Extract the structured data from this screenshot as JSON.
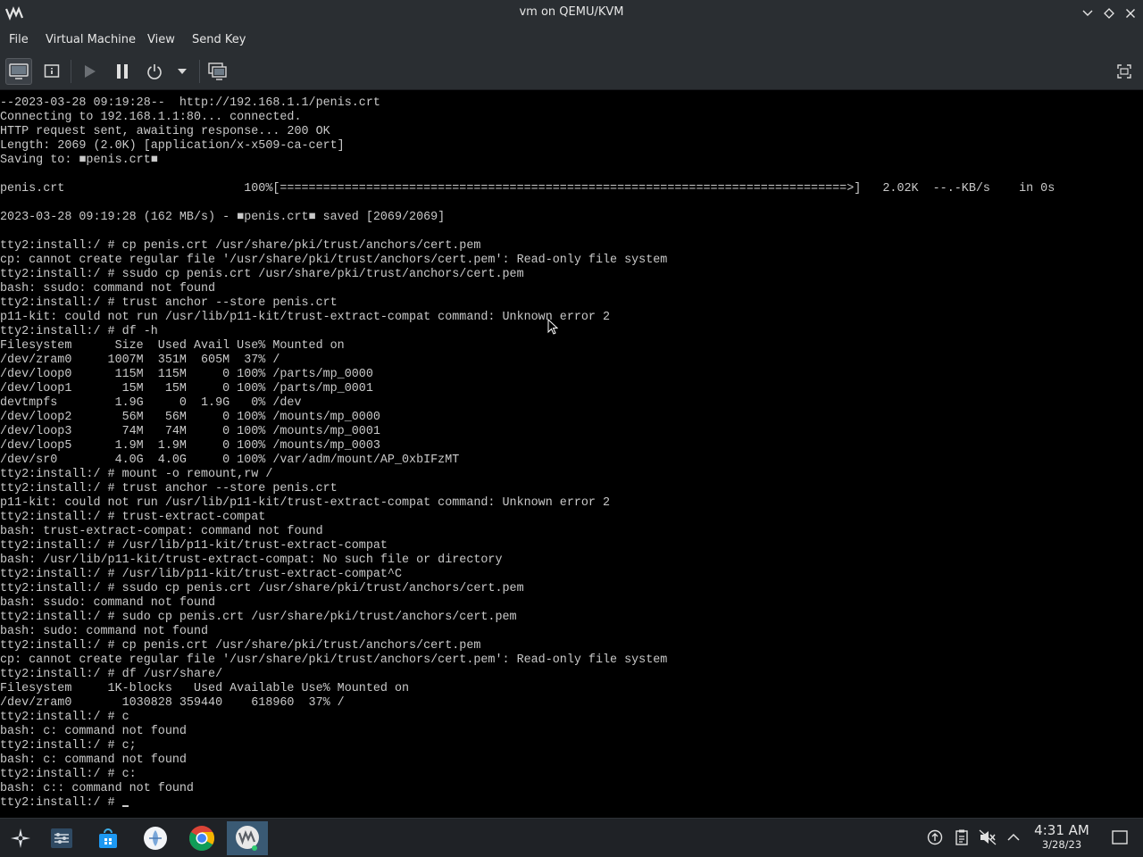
{
  "window": {
    "title": "vm on QEMU/KVM",
    "buttons": [
      "minimize",
      "maximize",
      "close"
    ]
  },
  "menu": {
    "file": "File",
    "virtual_machine": "Virtual Machine",
    "view": "View",
    "send_key": "Send Key"
  },
  "toolbar": {
    "icons": [
      "console-icon",
      "details-icon",
      "play-icon",
      "pause-icon",
      "power-icon",
      "dropdown-arrow-icon",
      "snapshots-icon",
      "fullscreen-icon"
    ],
    "active": "console-icon"
  },
  "console": {
    "lines": [
      "--2023-03-28 09:19:28--  http://192.168.1.1/penis.crt",
      "Connecting to 192.168.1.1:80... connected.",
      "HTTP request sent, awaiting response... 200 OK",
      "Length: 2069 (2.0K) [application/x-x509-ca-cert]",
      "Saving to: ■penis.crt■",
      "",
      "penis.crt                         100%[===============================================================================>]   2.02K  --.-KB/s    in 0s",
      "",
      "2023-03-28 09:19:28 (162 MB/s) - ■penis.crt■ saved [2069/2069]",
      "",
      "tty2:install:/ # cp penis.crt /usr/share/pki/trust/anchors/cert.pem",
      "cp: cannot create regular file '/usr/share/pki/trust/anchors/cert.pem': Read-only file system",
      "tty2:install:/ # ssudo cp penis.crt /usr/share/pki/trust/anchors/cert.pem",
      "bash: ssudo: command not found",
      "tty2:install:/ # trust anchor --store penis.crt",
      "p11-kit: could not run /usr/lib/p11-kit/trust-extract-compat command: Unknown error 2",
      "tty2:install:/ # df -h",
      "Filesystem      Size  Used Avail Use% Mounted on",
      "/dev/zram0     1007M  351M  605M  37% /",
      "/dev/loop0      115M  115M     0 100% /parts/mp_0000",
      "/dev/loop1       15M   15M     0 100% /parts/mp_0001",
      "devtmpfs        1.9G     0  1.9G   0% /dev",
      "/dev/loop2       56M   56M     0 100% /mounts/mp_0000",
      "/dev/loop3       74M   74M     0 100% /mounts/mp_0001",
      "/dev/loop5      1.9M  1.9M     0 100% /mounts/mp_0003",
      "/dev/sr0        4.0G  4.0G     0 100% /var/adm/mount/AP_0xbIFzMT",
      "tty2:install:/ # mount -o remount,rw /",
      "tty2:install:/ # trust anchor --store penis.crt",
      "p11-kit: could not run /usr/lib/p11-kit/trust-extract-compat command: Unknown error 2",
      "tty2:install:/ # trust-extract-compat",
      "bash: trust-extract-compat: command not found",
      "tty2:install:/ # /usr/lib/p11-kit/trust-extract-compat",
      "bash: /usr/lib/p11-kit/trust-extract-compat: No such file or directory",
      "tty2:install:/ # /usr/lib/p11-kit/trust-extract-compat^C",
      "tty2:install:/ # ssudo cp penis.crt /usr/share/pki/trust/anchors/cert.pem",
      "bash: ssudo: command not found",
      "tty2:install:/ # sudo cp penis.crt /usr/share/pki/trust/anchors/cert.pem",
      "bash: sudo: command not found",
      "tty2:install:/ # cp penis.crt /usr/share/pki/trust/anchors/cert.pem",
      "cp: cannot create regular file '/usr/share/pki/trust/anchors/cert.pem': Read-only file system",
      "tty2:install:/ # df /usr/share/",
      "Filesystem     1K-blocks   Used Available Use% Mounted on",
      "/dev/zram0       1030828 359440    618960  37% /",
      "tty2:install:/ # c",
      "bash: c: command not found",
      "tty2:install:/ # c;",
      "bash: c: command not found",
      "tty2:install:/ # c:",
      "bash: c:: command not found"
    ],
    "prompt": "tty2:install:/ # "
  },
  "taskbar": {
    "apps": [
      "application-launcher-icon",
      "settings-icon",
      "discover-store-icon",
      "app-icon",
      "chrome-icon",
      "virt-manager-icon"
    ],
    "active_app": "virt-manager-icon",
    "tray": [
      "updates-icon",
      "clipboard-icon",
      "volume-muted-icon",
      "show-hidden-icon"
    ],
    "clock_time": "4:31 AM",
    "clock_date": "3/28/23",
    "show_desktop": "show-desktop-icon"
  }
}
